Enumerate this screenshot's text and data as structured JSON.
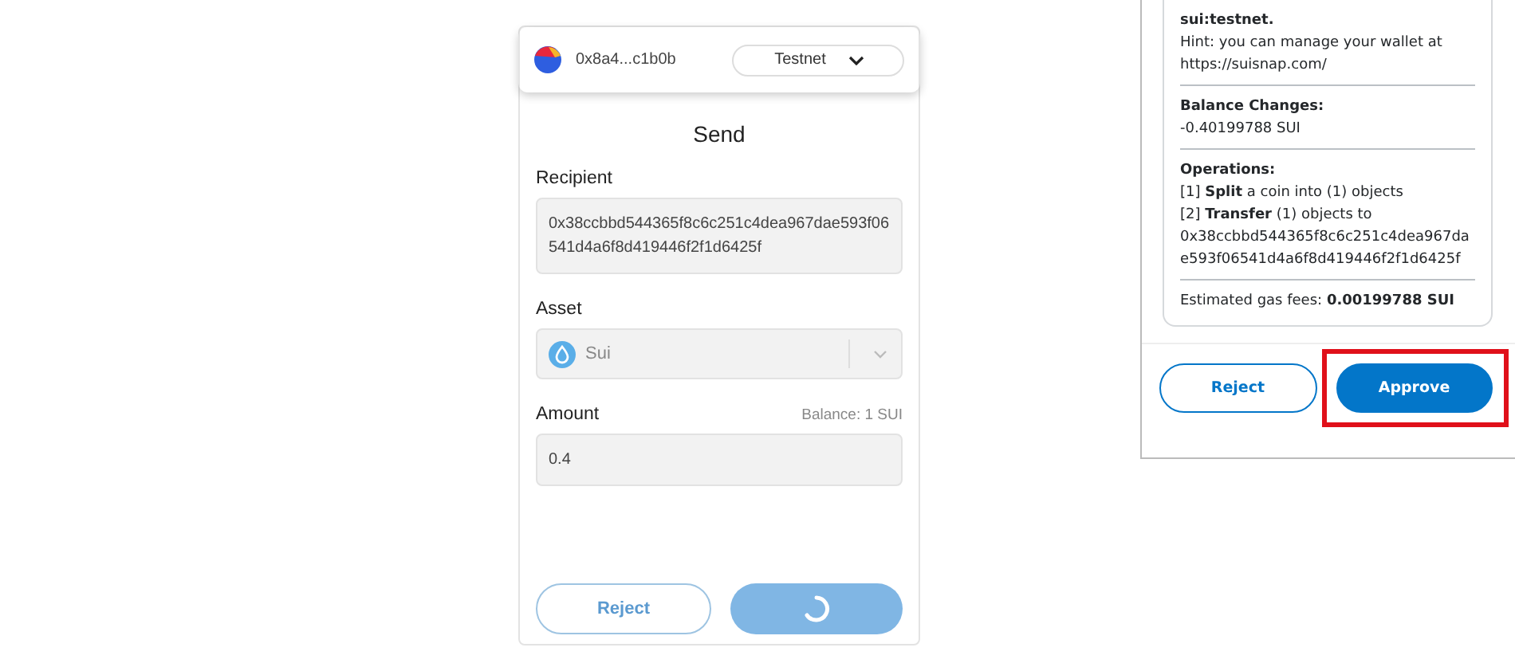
{
  "wallet": {
    "address": "0x8a4...c1b0b",
    "network": "Testnet"
  },
  "send": {
    "title": "Send",
    "recipient": {
      "label": "Recipient",
      "value": "0x38ccbbd544365f8c6c251c4dea967dae593f06541d4a6f8d419446f2f1d6425f"
    },
    "asset": {
      "label": "Asset",
      "value": "Sui",
      "disabled": true
    },
    "amount": {
      "label": "Amount",
      "balance": "Balance: 1 SUI",
      "value": "0.4"
    },
    "buttons": [
      {
        "kind": "outline",
        "label": "Reject"
      },
      {
        "kind": "loading"
      }
    ]
  },
  "snap": {
    "network": "sui:testnet.",
    "hint": "Hint: you can manage your wallet at https://suisnap.com/",
    "sections": [
      {
        "heading": "Balance Changes:",
        "lines": [
          "-0.40199788 SUI"
        ]
      },
      {
        "heading": "Operations:",
        "lines": [
          "[1] **Split** a coin into (1) objects",
          "[2] **Transfer** (1) objects to 0x38ccbbd544365f8c6c251c4dea967dae593f06541d4a6f8d419446f2f1d6425f"
        ]
      },
      {
        "lines": [
          "Estimated gas fees: **0.00199788 SUI**"
        ]
      }
    ],
    "buttons": [
      {
        "kind": "outline",
        "label": "Reject",
        "highlighted": false
      },
      {
        "kind": "primary",
        "label": "Approve",
        "highlighted": true
      }
    ]
  }
}
